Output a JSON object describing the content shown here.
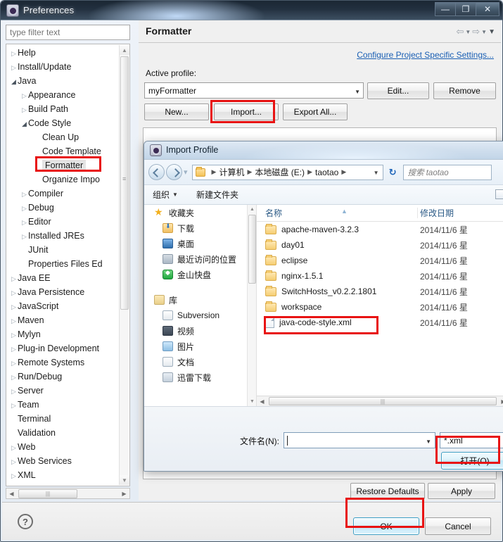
{
  "prefs": {
    "title": "Preferences",
    "window_controls": {
      "minimize": "—",
      "maximize": "❐",
      "close": "✕"
    },
    "filter_placeholder": "type filter text",
    "tree": [
      {
        "label": "Help",
        "indent": 0,
        "arrow": "closed"
      },
      {
        "label": "Install/Update",
        "indent": 0,
        "arrow": "closed"
      },
      {
        "label": "Java",
        "indent": 0,
        "arrow": "open"
      },
      {
        "label": "Appearance",
        "indent": 1,
        "arrow": "closed"
      },
      {
        "label": "Build Path",
        "indent": 1,
        "arrow": "closed"
      },
      {
        "label": "Code Style",
        "indent": 1,
        "arrow": "open"
      },
      {
        "label": "Clean Up",
        "indent": 2,
        "arrow": "none"
      },
      {
        "label": "Code Template",
        "indent": 2,
        "arrow": "none"
      },
      {
        "label": "Formatter",
        "indent": 2,
        "arrow": "none",
        "selected": true
      },
      {
        "label": "Organize Impo",
        "indent": 2,
        "arrow": "none"
      },
      {
        "label": "Compiler",
        "indent": 1,
        "arrow": "closed"
      },
      {
        "label": "Debug",
        "indent": 1,
        "arrow": "closed"
      },
      {
        "label": "Editor",
        "indent": 1,
        "arrow": "closed"
      },
      {
        "label": "Installed JREs",
        "indent": 1,
        "arrow": "closed"
      },
      {
        "label": "JUnit",
        "indent": 1,
        "arrow": "none"
      },
      {
        "label": "Properties Files Ed",
        "indent": 1,
        "arrow": "none"
      },
      {
        "label": "Java EE",
        "indent": 0,
        "arrow": "closed"
      },
      {
        "label": "Java Persistence",
        "indent": 0,
        "arrow": "closed"
      },
      {
        "label": "JavaScript",
        "indent": 0,
        "arrow": "closed"
      },
      {
        "label": "Maven",
        "indent": 0,
        "arrow": "closed"
      },
      {
        "label": "Mylyn",
        "indent": 0,
        "arrow": "closed"
      },
      {
        "label": "Plug-in Development",
        "indent": 0,
        "arrow": "closed"
      },
      {
        "label": "Remote Systems",
        "indent": 0,
        "arrow": "closed"
      },
      {
        "label": "Run/Debug",
        "indent": 0,
        "arrow": "closed"
      },
      {
        "label": "Server",
        "indent": 0,
        "arrow": "closed"
      },
      {
        "label": "Team",
        "indent": 0,
        "arrow": "closed"
      },
      {
        "label": "Terminal",
        "indent": 0,
        "arrow": "none"
      },
      {
        "label": "Validation",
        "indent": 0,
        "arrow": "none"
      },
      {
        "label": "Web",
        "indent": 0,
        "arrow": "closed"
      },
      {
        "label": "Web Services",
        "indent": 0,
        "arrow": "closed"
      },
      {
        "label": "XML",
        "indent": 0,
        "arrow": "closed"
      }
    ],
    "content": {
      "title": "Formatter",
      "config_link": "Configure Project Specific Settings...",
      "active_profile_label": "Active profile:",
      "active_profile_value": "myFormatter",
      "buttons": {
        "edit": "Edit...",
        "remove": "Remove",
        "new": "New...",
        "import": "Import...",
        "export_all": "Export All...",
        "restore_defaults": "Restore Defaults",
        "apply": "Apply"
      }
    },
    "footer": {
      "help": "?",
      "ok": "OK",
      "cancel": "Cancel"
    }
  },
  "import_dialog": {
    "title": "Import Profile",
    "breadcrumbs": [
      "计算机",
      "本地磁盘 (E:)",
      "taotao"
    ],
    "search_placeholder": "搜索 taotao",
    "toolbar": {
      "organize": "组织",
      "new_folder": "新建文件夹"
    },
    "nav_pane": [
      {
        "label": "收藏夹",
        "icon": "star-icon",
        "sub": false
      },
      {
        "label": "下载",
        "icon": "download-icon",
        "sub": true
      },
      {
        "label": "桌面",
        "icon": "desktop-icon",
        "sub": true
      },
      {
        "label": "最近访问的位置",
        "icon": "recent-icon",
        "sub": true
      },
      {
        "label": "金山快盘",
        "icon": "kingsoft-icon",
        "sub": true
      },
      {
        "label": "库",
        "icon": "library-icon",
        "sub": false,
        "spacer_before": true
      },
      {
        "label": "Subversion",
        "icon": "document-icon",
        "sub": true
      },
      {
        "label": "视频",
        "icon": "video-icon",
        "sub": true
      },
      {
        "label": "图片",
        "icon": "picture-icon",
        "sub": true
      },
      {
        "label": "文档",
        "icon": "document-icon",
        "sub": true
      },
      {
        "label": "迅雷下载",
        "icon": "thunder-icon",
        "sub": true
      }
    ],
    "columns": {
      "name": "名称",
      "date": "修改日期"
    },
    "files": [
      {
        "name": "apache-maven-3.2.3",
        "date": "2014/11/6 星",
        "type": "folder"
      },
      {
        "name": "day01",
        "date": "2014/11/6 星",
        "type": "folder"
      },
      {
        "name": "eclipse",
        "date": "2014/11/6 星",
        "type": "folder"
      },
      {
        "name": "nginx-1.5.1",
        "date": "2014/11/6 星",
        "type": "folder"
      },
      {
        "name": "SwitchHosts_v0.2.2.1801",
        "date": "2014/11/6 星",
        "type": "folder"
      },
      {
        "name": "workspace",
        "date": "2014/11/6 星",
        "type": "folder"
      },
      {
        "name": "java-code-style.xml",
        "date": "2014/11/6 星",
        "type": "xml"
      }
    ],
    "filename_label": "文件名(N):",
    "filename_value": "",
    "filetype_value": "*.xml",
    "open_button": "打开(O)"
  },
  "annotations": {
    "highlight_color": "#e81313",
    "boxes": [
      "formatter-tree-item",
      "import-button",
      "java-code-style-file",
      "open-button",
      "ok-button"
    ]
  }
}
